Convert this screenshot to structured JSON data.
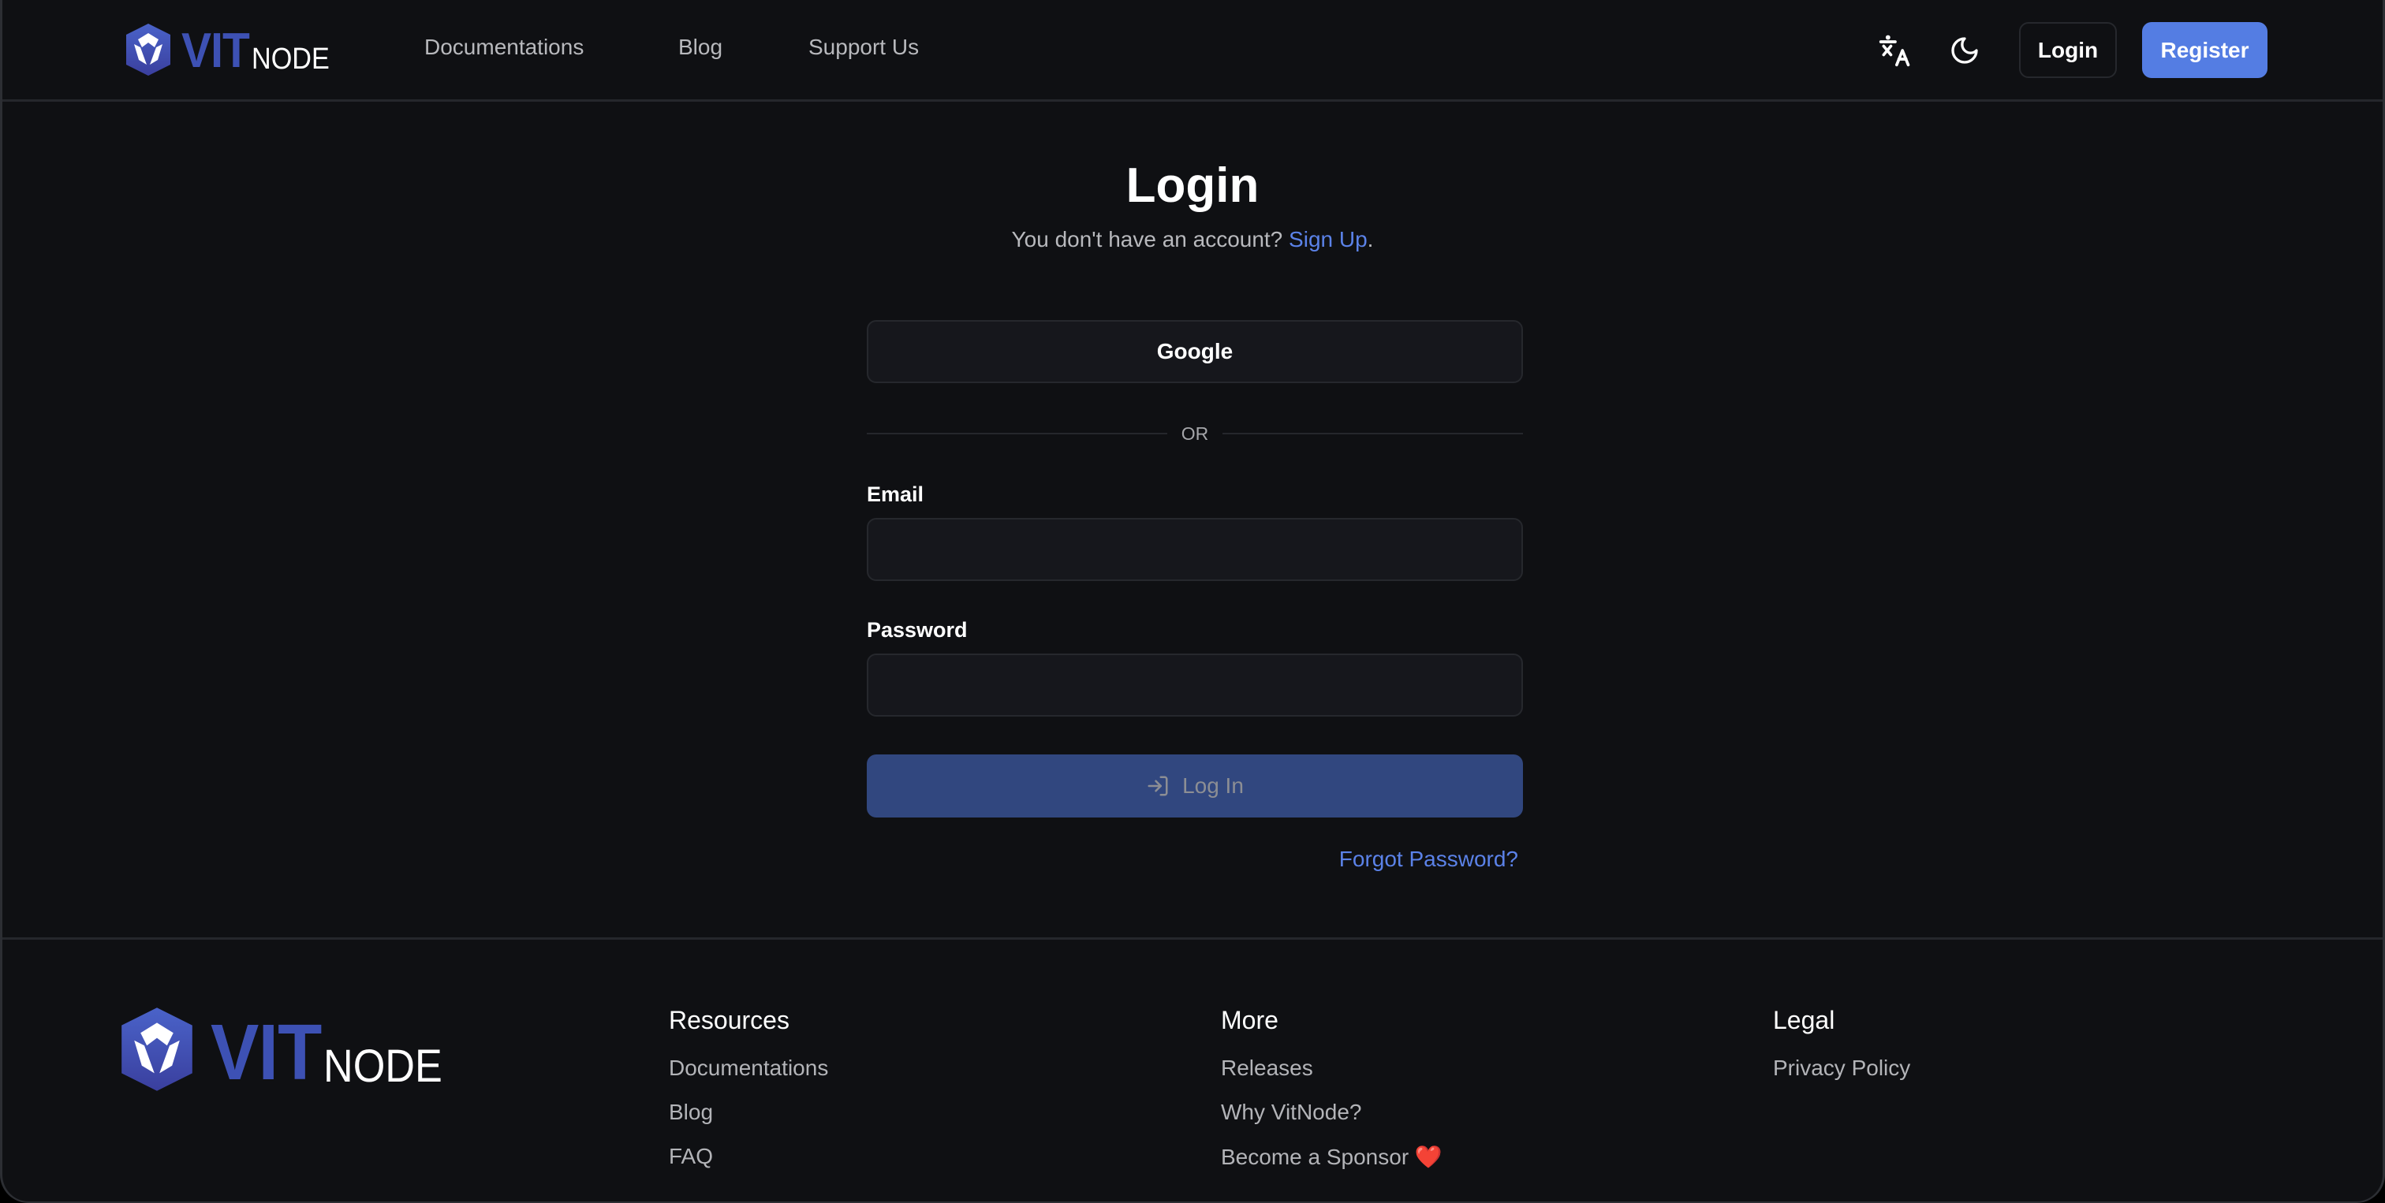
{
  "brand": {
    "logo_primary": "VIT",
    "logo_secondary": "NODE",
    "logo_color": "#3d51b4"
  },
  "header": {
    "nav": [
      {
        "label": "Documentations"
      },
      {
        "label": "Blog"
      },
      {
        "label": "Support Us"
      }
    ],
    "icons": {
      "language": "translate-icon",
      "theme": "moon-icon"
    },
    "login_label": "Login",
    "register_label": "Register",
    "accent_color": "#547de3"
  },
  "main": {
    "title": "Login",
    "subtitle_prefix": "You don't have an account?",
    "signup_link": "Sign Up",
    "subtitle_suffix": ".",
    "google_button": "Google",
    "divider_text": "OR",
    "email": {
      "label": "Email",
      "value": "",
      "placeholder": ""
    },
    "password": {
      "label": "Password",
      "value": "",
      "placeholder": ""
    },
    "submit_label": "Log In",
    "submit_icon": "log-in-icon",
    "forgot_link": "Forgot Password?",
    "link_color": "#5b82e8"
  },
  "footer": {
    "columns": [
      {
        "heading": "Resources",
        "links": [
          "Documentations",
          "Blog",
          "FAQ"
        ]
      },
      {
        "heading": "More",
        "links": [
          "Releases",
          "Why VitNode?",
          "Become a Sponsor"
        ],
        "sponsor_emoji": "❤️"
      },
      {
        "heading": "Legal",
        "links": [
          "Privacy Policy"
        ]
      }
    ]
  }
}
